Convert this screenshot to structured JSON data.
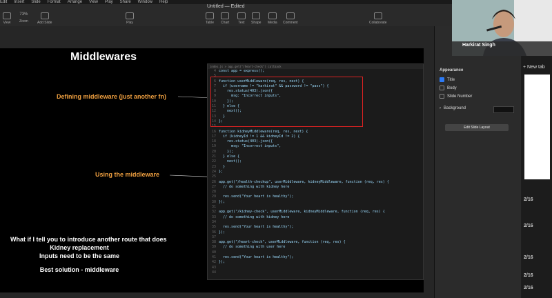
{
  "menu": [
    "Edit",
    "Insert",
    "Slide",
    "Format",
    "Arrange",
    "View",
    "Play",
    "Share",
    "Window",
    "Help"
  ],
  "toolbar": {
    "left": [
      {
        "label": "View"
      },
      {
        "label": "Zoom",
        "value": "73%"
      },
      {
        "label": "Add Slide"
      }
    ],
    "center": [
      {
        "label": "Play"
      },
      {
        "label": "Table"
      },
      {
        "label": "Chart"
      },
      {
        "label": "Text"
      },
      {
        "label": "Shape"
      },
      {
        "label": "Media"
      },
      {
        "label": "Comment"
      }
    ],
    "right": [
      {
        "label": "Collaborate"
      }
    ],
    "doc_title": "Untitled — Edited"
  },
  "slide": {
    "title": "Middlewares",
    "note1": "Defining middleware (just another fn)",
    "note2": "Using the middleware",
    "question": [
      "What if I tell you to introduce another route that does",
      "Kidney replacement",
      "Inputs need to be the same",
      "",
      "Best solution - middleware"
    ]
  },
  "code": {
    "tabs": "index.js  >  app.get(\"/heart-check\") callback",
    "lines": [
      {
        "n": "4",
        "t": "const app = express();"
      },
      {
        "n": "5",
        "t": ""
      },
      {
        "n": "6",
        "t": "function userMiddleware(req, res, next) {"
      },
      {
        "n": "7",
        "t": "  if (username != \"harkirat\" && password != \"pass\") {"
      },
      {
        "n": "8",
        "t": "    res.status(403).json({"
      },
      {
        "n": "9",
        "t": "      msg: \"Incorrect inputs\","
      },
      {
        "n": "10",
        "t": "    });"
      },
      {
        "n": "11",
        "t": "  } else {"
      },
      {
        "n": "12",
        "t": "    next();"
      },
      {
        "n": "13",
        "t": "  }"
      },
      {
        "n": "14",
        "t": "};"
      },
      {
        "n": "15",
        "t": ""
      },
      {
        "n": "16",
        "t": "function kidneyMiddleware(req, res, next) {"
      },
      {
        "n": "17",
        "t": "  if (kidneyId != 1 && kidneyId != 2) {"
      },
      {
        "n": "18",
        "t": "    res.status(403).json({"
      },
      {
        "n": "19",
        "t": "      msg: \"Incorrect inputs\","
      },
      {
        "n": "20",
        "t": "    });"
      },
      {
        "n": "21",
        "t": "  } else {"
      },
      {
        "n": "22",
        "t": "    next();"
      },
      {
        "n": "23",
        "t": "  }"
      },
      {
        "n": "24",
        "t": "};"
      },
      {
        "n": "25",
        "t": ""
      },
      {
        "n": "26",
        "t": "app.get(\"/health-checkup\", userMiddleware, kidneyMiddleware, function (req, res) {"
      },
      {
        "n": "27",
        "t": "  // do something with kidney here"
      },
      {
        "n": "28",
        "t": ""
      },
      {
        "n": "29",
        "t": "  res.send(\"Your heart is healthy\");"
      },
      {
        "n": "30",
        "t": "});"
      },
      {
        "n": "31",
        "t": ""
      },
      {
        "n": "32",
        "t": "app.get(\"/kidney-check\", userMiddleware, kidneyMiddleware, function (req, res) {"
      },
      {
        "n": "33",
        "t": "  // do something with kidney here"
      },
      {
        "n": "34",
        "t": ""
      },
      {
        "n": "35",
        "t": "  res.send(\"Your heart is healthy\");"
      },
      {
        "n": "36",
        "t": "});"
      },
      {
        "n": "37",
        "t": ""
      },
      {
        "n": "38",
        "t": "app.get(\"/heart-check\", userMiddleware, function (req, res) {"
      },
      {
        "n": "39",
        "t": "  // do something with user here"
      },
      {
        "n": "40",
        "t": ""
      },
      {
        "n": "41",
        "t": "  res.send(\"Your heart is healthy\");"
      },
      {
        "n": "42",
        "t": "});"
      },
      {
        "n": "43",
        "t": ""
      },
      {
        "n": "44",
        "t": ""
      }
    ]
  },
  "format_panel": {
    "appearance": "Appearance",
    "title": "Title",
    "body": "Body",
    "slide_number": "Slide Number",
    "background": "Background",
    "edit_layout": "Edit Slide Layout"
  },
  "webcam": {
    "name": "Harkirat Singh"
  },
  "browser": {
    "new_tab": "New tab",
    "counters": [
      "2/16",
      "2/16",
      "2/16",
      "2/16",
      "2/16"
    ]
  }
}
